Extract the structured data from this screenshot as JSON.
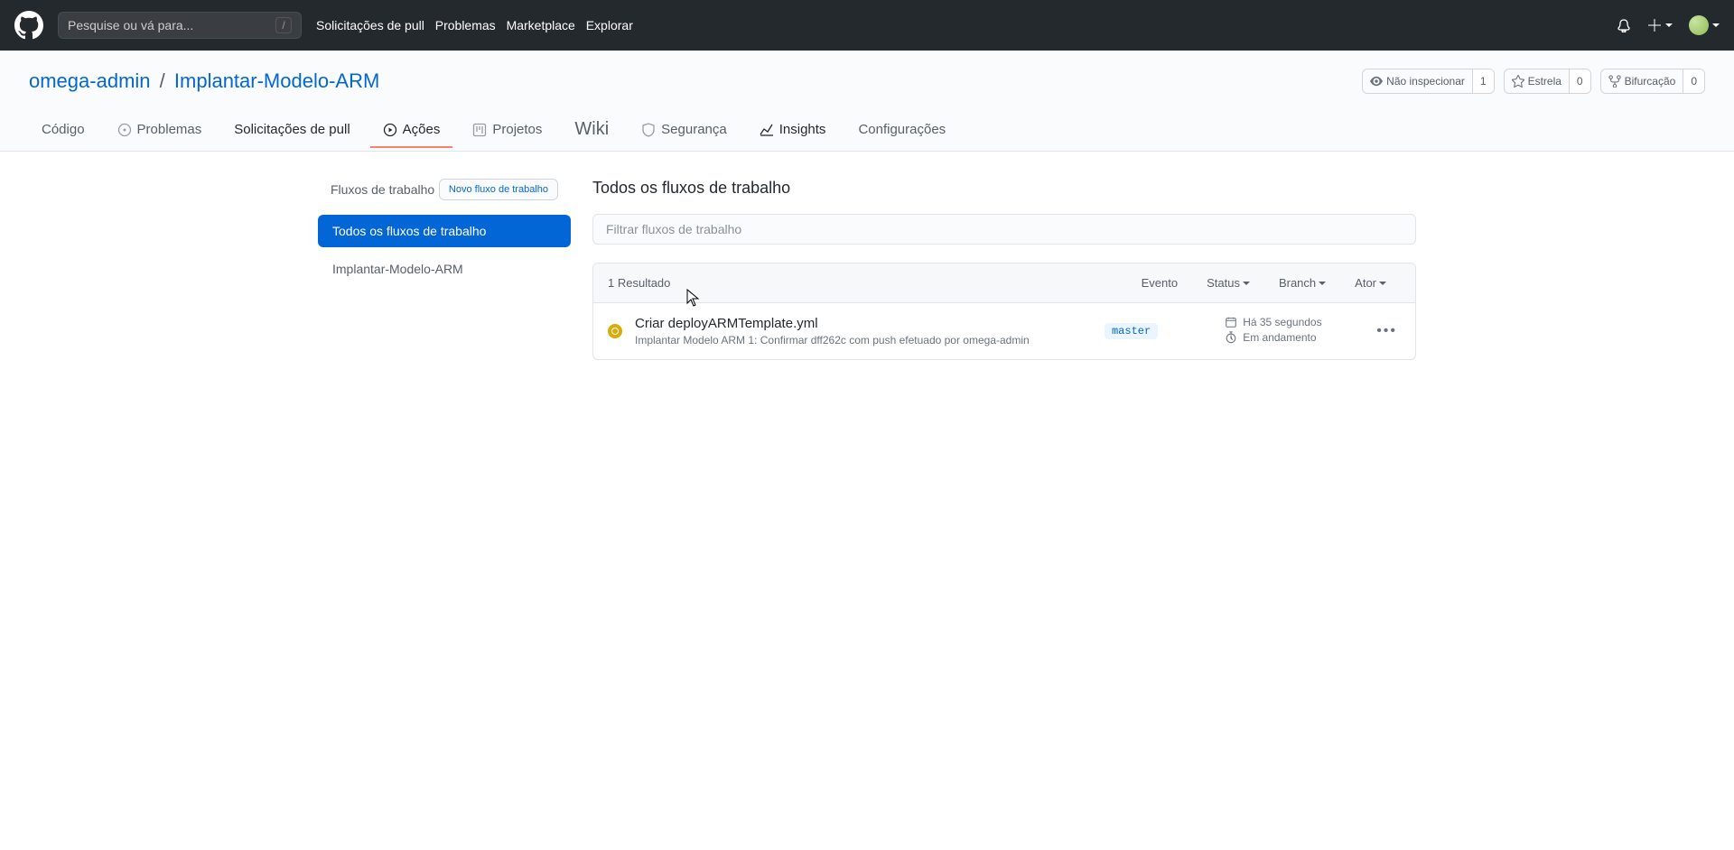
{
  "topnav": {
    "search_placeholder": "Pesquise ou vá para...",
    "slash": "/",
    "links": {
      "pull": "Solicitações de pull",
      "issues": "Problemas",
      "marketplace": "Marketplace",
      "explore": "Explorar"
    }
  },
  "repo": {
    "owner": "omega-admin",
    "sep": "/",
    "name": "Implantar-Modelo-ARM",
    "watch_label": "Não inspecionar",
    "watch_count": "1",
    "star_label": "Estrela",
    "star_count": "0",
    "fork_label": "Bifurcação",
    "fork_count": "0"
  },
  "tabs": {
    "code": "Código",
    "issues": "Problemas",
    "pulls": "Solicitações de pull",
    "actions": "Ações",
    "projects": "Projetos",
    "wiki": "Wiki",
    "security": "Segurança",
    "insights": "Insights",
    "settings": "Configurações"
  },
  "sidebar": {
    "title": "Fluxos de trabalho",
    "new_btn": "Novo fluxo de trabalho",
    "items": [
      {
        "label": "Todos os fluxos de trabalho"
      },
      {
        "label": "Implantar-Modelo-ARM"
      }
    ]
  },
  "main": {
    "heading": "Todos os fluxos de trabalho",
    "filter_placeholder": "Filtrar fluxos de trabalho",
    "result_count": "1 Resultado",
    "dropdowns": {
      "event": "Evento",
      "status": "Status",
      "branch": "Branch",
      "actor": "Ator"
    },
    "run": {
      "title": "Criar deployARMTemplate.yml",
      "sub": "Implantar Modelo ARM 1: Confirmar dff262c com push efetuado por omega-admin",
      "branch": "master",
      "time": "Há 35 segundos",
      "state": "Em andamento"
    }
  }
}
